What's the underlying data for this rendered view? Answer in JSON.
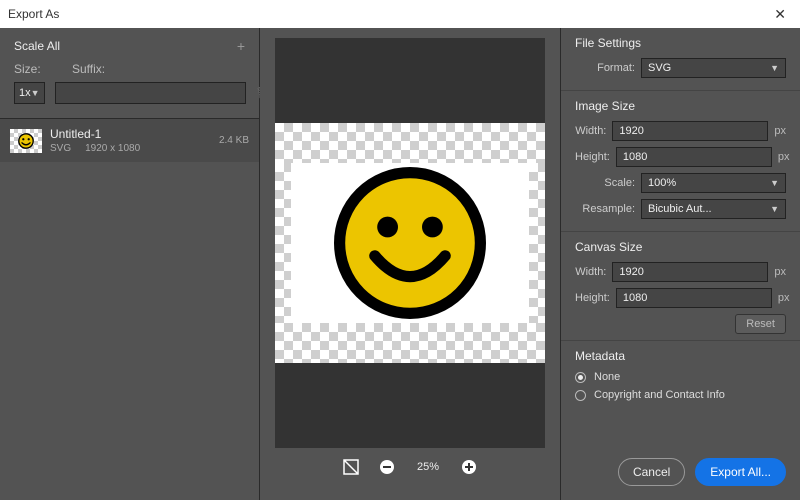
{
  "title": "Export As",
  "scaleAll": {
    "heading": "Scale All",
    "sizeLabel": "Size:",
    "suffixLabel": "Suffix:",
    "sizeValue": "1x",
    "suffixValue": ""
  },
  "asset": {
    "name": "Untitled-1",
    "format": "SVG",
    "dimensions": "1920 x 1080",
    "fileSize": "2.4 KB"
  },
  "zoom": {
    "level": "25%"
  },
  "fileSettings": {
    "heading": "File Settings",
    "formatLabel": "Format:",
    "formatValue": "SVG"
  },
  "imageSize": {
    "heading": "Image Size",
    "widthLabel": "Width:",
    "heightLabel": "Height:",
    "scaleLabel": "Scale:",
    "resampleLabel": "Resample:",
    "width": "1920",
    "height": "1080",
    "unit": "px",
    "scaleValue": "100%",
    "resampleValue": "Bicubic Aut..."
  },
  "canvasSize": {
    "heading": "Canvas Size",
    "widthLabel": "Width:",
    "heightLabel": "Height:",
    "width": "1920",
    "height": "1080",
    "unit": "px",
    "reset": "Reset"
  },
  "metadata": {
    "heading": "Metadata",
    "none": "None",
    "copyright": "Copyright and Contact Info",
    "selected": "none"
  },
  "buttons": {
    "cancel": "Cancel",
    "export": "Export All..."
  }
}
